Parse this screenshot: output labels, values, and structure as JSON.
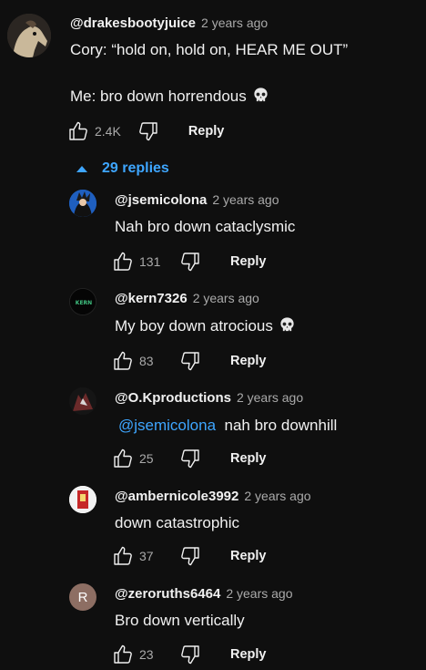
{
  "top_comment": {
    "author": "@drakesbootyjuice",
    "time": "2 years ago",
    "line1": "Cory: “hold on, hold on, HEAR ME OUT”",
    "line2": "Me: bro down horrendous",
    "likes": "2.4K",
    "reply_label": "Reply"
  },
  "replies_toggle": {
    "label": "29 replies",
    "icon": "chevron-up-icon",
    "color": "#3ea6ff"
  },
  "replies": [
    {
      "author": "@jsemicolona",
      "time": "2 years ago",
      "text": "Nah bro down cataclysmic",
      "likes": "131",
      "reply_label": "Reply",
      "avatar": "anime-avatar"
    },
    {
      "author": "@kern7326",
      "time": "2 years ago",
      "text": "My boy down atrocious",
      "likes": "83",
      "reply_label": "Reply",
      "avatar": "kern-logo-avatar",
      "avatar_text": "KERN"
    },
    {
      "author": "@O.Kproductions",
      "time": "2 years ago",
      "mention": "@jsemicolona",
      "text": "nah bro downhill",
      "likes": "25",
      "reply_label": "Reply",
      "avatar": "dark-figure-avatar"
    },
    {
      "author": "@ambernicole3992",
      "time": "2 years ago",
      "text": "down catastrophic",
      "likes": "37",
      "reply_label": "Reply",
      "avatar": "red-white-avatar"
    },
    {
      "author": "@zeroruths6464",
      "time": "2 years ago",
      "text": "Bro down vertically",
      "likes": "23",
      "reply_label": "Reply",
      "avatar": "letter-avatar",
      "avatar_letter": "R",
      "avatar_color": "#8d6e63"
    }
  ]
}
